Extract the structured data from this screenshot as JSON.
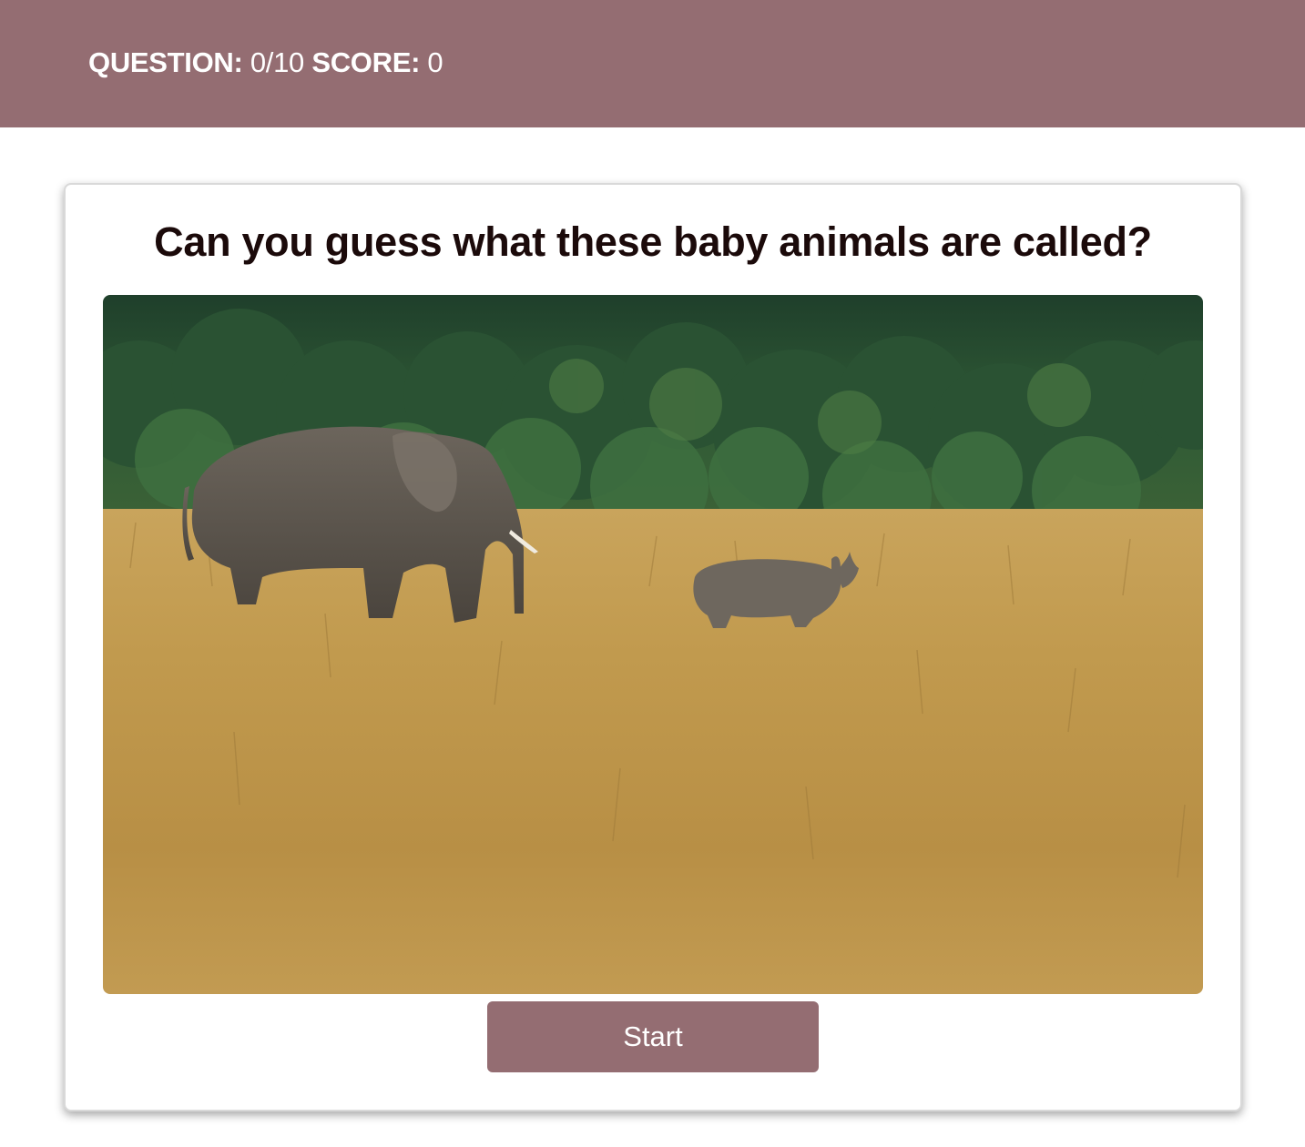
{
  "header": {
    "question_label": "QUESTION:",
    "question_value": "0/10",
    "score_label": "SCORE:",
    "score_value": "0",
    "background_color": "#946d72"
  },
  "quiz": {
    "title": "Can you guess what these baby animals are called?",
    "image": {
      "subject": "adult-elephant-and-baby-elephant-in-savanna"
    },
    "start_label": "Start",
    "button_color": "#946d72"
  }
}
